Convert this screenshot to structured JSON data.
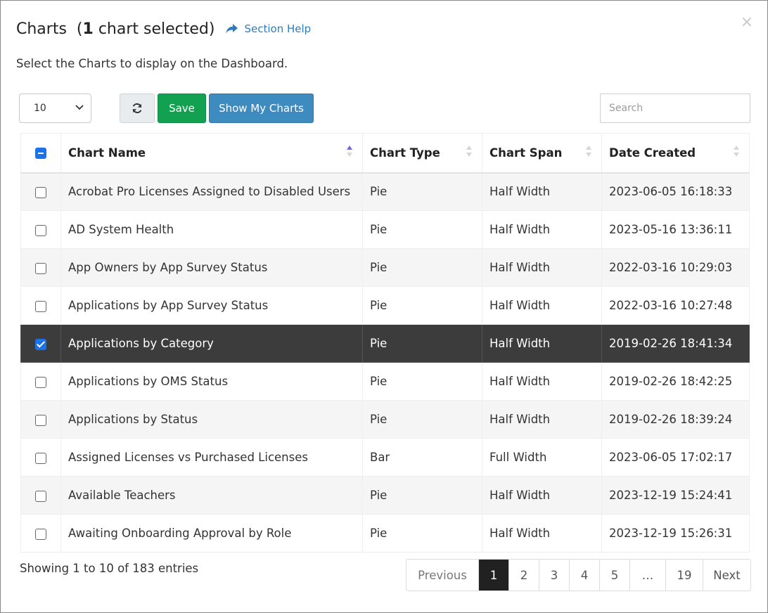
{
  "header": {
    "title": "Charts",
    "count_open": "(",
    "count_number": "1",
    "count_rest": " chart selected)",
    "help_label": "Section Help",
    "close_glyph": "×"
  },
  "subtitle": "Select the Charts to display on the Dashboard.",
  "toolbar": {
    "page_length": "10",
    "save_label": "Save",
    "show_my_charts_label": "Show My Charts",
    "search_placeholder": "Search",
    "search_value": ""
  },
  "table": {
    "columns": [
      "Chart Name",
      "Chart Type",
      "Chart Span",
      "Date Created"
    ],
    "sorted_column": "Chart Name",
    "sort_direction": "ascending",
    "rows": [
      {
        "name": "Acrobat Pro Licenses Assigned to Disabled Users",
        "type": "Pie",
        "span": "Half Width",
        "created": "2023-06-05 16:18:33",
        "checked": false
      },
      {
        "name": "AD System Health",
        "type": "Pie",
        "span": "Half Width",
        "created": "2023-05-16 13:36:11",
        "checked": false
      },
      {
        "name": "App Owners by App Survey Status",
        "type": "Pie",
        "span": "Half Width",
        "created": "2022-03-16 10:29:03",
        "checked": false
      },
      {
        "name": "Applications by App Survey Status",
        "type": "Pie",
        "span": "Half Width",
        "created": "2022-03-16 10:27:48",
        "checked": false
      },
      {
        "name": "Applications by Category",
        "type": "Pie",
        "span": "Half Width",
        "created": "2019-02-26 18:41:34",
        "checked": true
      },
      {
        "name": "Applications by OMS Status",
        "type": "Pie",
        "span": "Half Width",
        "created": "2019-02-26 18:42:25",
        "checked": false
      },
      {
        "name": "Applications by Status",
        "type": "Pie",
        "span": "Half Width",
        "created": "2019-02-26 18:39:24",
        "checked": false
      },
      {
        "name": "Assigned Licenses vs Purchased Licenses",
        "type": "Bar",
        "span": "Full Width",
        "created": "2023-06-05 17:02:17",
        "checked": false
      },
      {
        "name": "Available Teachers",
        "type": "Pie",
        "span": "Half Width",
        "created": "2023-12-19 15:24:41",
        "checked": false
      },
      {
        "name": "Awaiting Onboarding Approval by Role",
        "type": "Pie",
        "span": "Half Width",
        "created": "2023-12-19 15:26:31",
        "checked": false
      }
    ]
  },
  "footer": {
    "info": "Showing 1 to 10 of 183 entries",
    "pagination": {
      "previous": "Previous",
      "pages": [
        "1",
        "2",
        "3",
        "4",
        "5",
        "…",
        "19"
      ],
      "current": "1",
      "next": "Next"
    }
  },
  "colors": {
    "save_green": "#12a150",
    "primary_blue": "#3e8bc0",
    "selected_row": "#3c3c3c",
    "link_blue": "#2f7bbd",
    "checkbox_blue": "#1a73e8"
  },
  "icons": {
    "help": "share-arrow-icon",
    "refresh": "refresh-icon",
    "dropdown": "chevron-down-icon",
    "close": "close-icon"
  }
}
